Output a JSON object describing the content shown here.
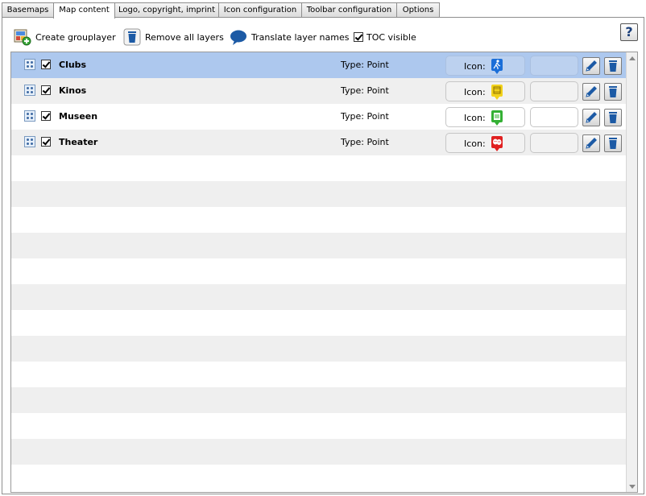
{
  "tabs": [
    {
      "label": "Basemaps"
    },
    {
      "label": "Map content"
    },
    {
      "label": "Logo, copyright, imprint"
    },
    {
      "label": "Icon configuration"
    },
    {
      "label": "Toolbar configuration"
    },
    {
      "label": "Options"
    }
  ],
  "active_tab": "Map content",
  "toolbar": {
    "create_grouplayer": "Create grouplayer",
    "remove_all_layers": "Remove all layers",
    "translate_layer_names": "Translate layer names",
    "toc_visible": "TOC visible",
    "toc_visible_checked": true,
    "help": "?"
  },
  "layers": [
    {
      "name": "Clubs",
      "type": "Type: Point",
      "icon_label": "Icon:",
      "icon_color": "#1a6ed8",
      "icon_glyph": "walking-person-icon",
      "checked": true,
      "selected": true
    },
    {
      "name": "Kinos",
      "type": "Type: Point",
      "icon_label": "Icon:",
      "icon_color": "#f2d21c",
      "icon_glyph": "film-icon",
      "checked": true,
      "selected": false
    },
    {
      "name": "Museen",
      "type": "Type: Point",
      "icon_label": "Icon:",
      "icon_color": "#34b034",
      "icon_glyph": "museum-icon",
      "checked": true,
      "selected": false
    },
    {
      "name": "Theater",
      "type": "Type: Point",
      "icon_label": "Icon:",
      "icon_color": "#e02020",
      "icon_glyph": "theater-masks-icon",
      "checked": true,
      "selected": false
    }
  ],
  "colors": {
    "selected_row": "#adc8ee",
    "stripe": "#efefef",
    "accent_blue": "#1c5aa5"
  }
}
